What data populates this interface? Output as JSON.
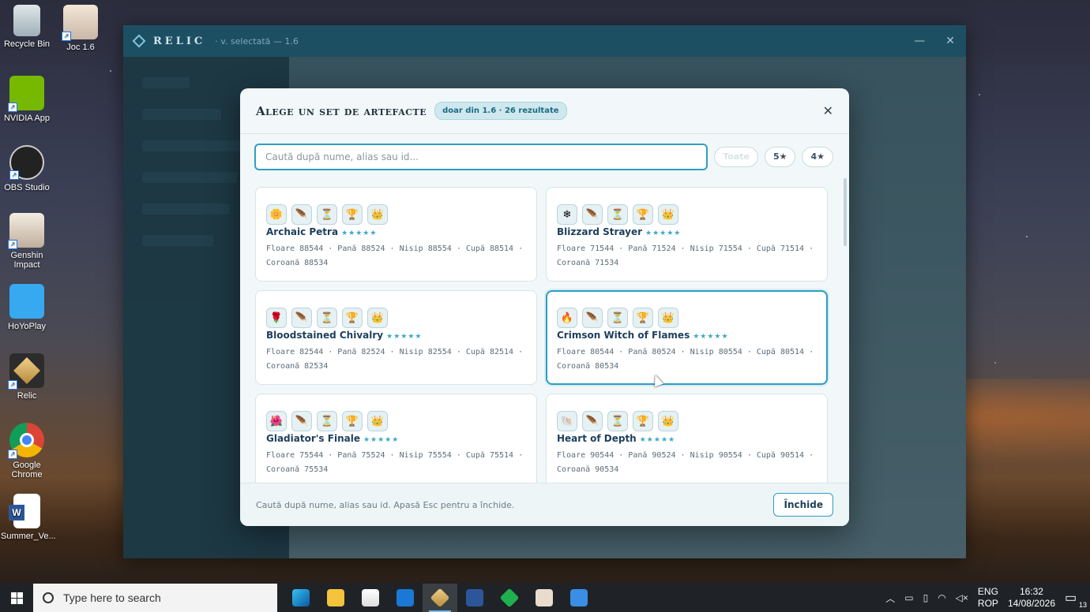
{
  "desktop": {
    "icons": [
      {
        "label": "Recycle Bin"
      },
      {
        "label": "Joc 1.6"
      },
      {
        "label": "NVIDIA App"
      },
      {
        "label": "OBS Studio"
      },
      {
        "label": "Genshin Impact"
      },
      {
        "label": "HoYoPlay"
      },
      {
        "label": "Relic"
      },
      {
        "label": "Google Chrome"
      },
      {
        "label": "Summer_Ve..."
      }
    ]
  },
  "window": {
    "brand": "RELIC",
    "subtitle": "· v. selectată — 1.6",
    "minimize": "—",
    "close": "✕"
  },
  "modal": {
    "title": "Alege un set de artefacte",
    "badge": "doar din 1.6 · 26 rezultate",
    "close": "✕",
    "search_placeholder": "Caută după nume, alias sau id...",
    "search_value": "",
    "filters": [
      "Toate",
      "5★",
      "4★"
    ],
    "footer_hint": "Caută după nume, alias sau id. Apasă Esc pentru a închide.",
    "close_button": "Închide",
    "sets": [
      {
        "name": "Archaic Petra",
        "stars": "★★★★★",
        "line1": "Floare 88544 · Pană 88524 · Nisip 88554 · Cupă 88514 ·",
        "line2": "Coroană 88534",
        "icons": [
          "🌼",
          "🪶",
          "⏳",
          "🏆",
          "👑"
        ],
        "selected": false
      },
      {
        "name": "Blizzard Strayer",
        "stars": "★★★★★",
        "line1": "Floare 71544 · Pană 71524 · Nisip 71554 · Cupă 71514 ·",
        "line2": "Coroană 71534",
        "icons": [
          "❄",
          "🪶",
          "⏳",
          "🏆",
          "👑"
        ],
        "selected": false
      },
      {
        "name": "Bloodstained Chivalry",
        "stars": "★★★★★",
        "line1": "Floare 82544 · Pană 82524 · Nisip 82554 · Cupă 82514 ·",
        "line2": "Coroană 82534",
        "icons": [
          "🌹",
          "🪶",
          "⏳",
          "🏆",
          "👑"
        ],
        "selected": false
      },
      {
        "name": "Crimson Witch of Flames",
        "stars": "★★★★★",
        "line1": "Floare 80544 · Pană 80524 · Nisip 80554 · Cupă 80514 ·",
        "line2": "Coroană 80534",
        "icons": [
          "🔥",
          "🪶",
          "⏳",
          "🏆",
          "👑"
        ],
        "selected": true
      },
      {
        "name": "Gladiator's Finale",
        "stars": "★★★★★",
        "line1": "Floare 75544 · Pană 75524 · Nisip 75554 · Cupă 75514 ·",
        "line2": "Coroană 75534",
        "icons": [
          "🌺",
          "🪶",
          "⏳",
          "🏆",
          "👑"
        ],
        "selected": false
      },
      {
        "name": "Heart of Depth",
        "stars": "★★★★★",
        "line1": "Floare 90544 · Pană 90524 · Nisip 90554 · Cupă 90514 ·",
        "line2": "Coroană 90534",
        "icons": [
          "🐚",
          "🪶",
          "⏳",
          "🏆",
          "👑"
        ],
        "selected": false
      }
    ]
  },
  "taskbar": {
    "search_placeholder": "Type here to search",
    "apps": [
      "edge-icon",
      "file-explorer-icon",
      "store-icon",
      "outlook-icon",
      "relic-icon",
      "word-icon",
      "app-green-icon",
      "genshin-icon",
      "photos-icon"
    ],
    "active_app": "relic-icon",
    "lang_top": "ENG",
    "lang_bottom": "ROP",
    "time": "16:32",
    "date": "14/08/2026",
    "notification_count": "13"
  },
  "colors": {
    "accent": "#2a9fc2",
    "titlebar": "#1d4f63"
  }
}
